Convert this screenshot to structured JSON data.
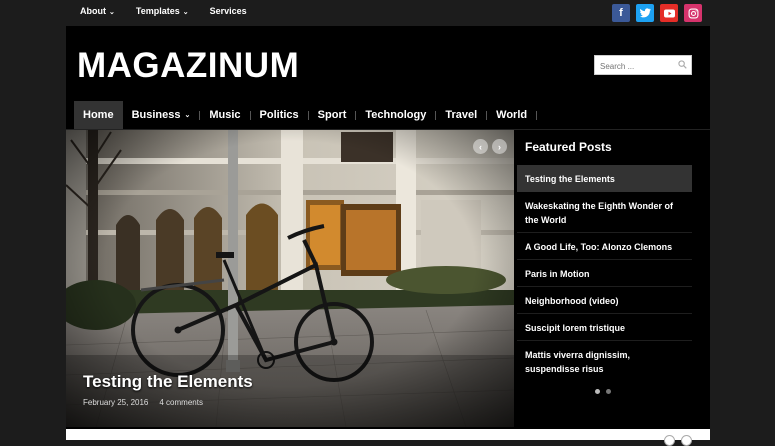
{
  "topnav": {
    "items": [
      {
        "label": "About",
        "has_dropdown": true
      },
      {
        "label": "Templates",
        "has_dropdown": true
      },
      {
        "label": "Services",
        "has_dropdown": false
      }
    ]
  },
  "social": {
    "facebook": {
      "icon": "facebook-icon",
      "glyph": "f",
      "color": "#3b5998"
    },
    "twitter": {
      "icon": "twitter-icon",
      "glyph": "t",
      "color": "#1da1f2"
    },
    "youtube": {
      "icon": "youtube-icon",
      "glyph": "▶",
      "color": "#e52d27"
    },
    "instagram": {
      "icon": "instagram-icon",
      "glyph": "◎",
      "color": "#d6336c"
    }
  },
  "header": {
    "logo": "MAGAZINUM",
    "search_placeholder": "Search ..."
  },
  "mainnav": {
    "items": [
      {
        "label": "Home",
        "active": true
      },
      {
        "label": "Business",
        "has_dropdown": true
      },
      {
        "label": "Music"
      },
      {
        "label": "Politics"
      },
      {
        "label": "Sport"
      },
      {
        "label": "Technology"
      },
      {
        "label": "Travel"
      },
      {
        "label": "World"
      }
    ]
  },
  "slider": {
    "title": "Testing the Elements",
    "date": "February 25, 2016",
    "comments": "4 comments",
    "prev_glyph": "‹",
    "next_glyph": "›"
  },
  "featured": {
    "heading": "Featured Posts",
    "items": [
      "Testing the Elements",
      "Wakeskating the Eighth Wonder of the World",
      "A Good Life, Too: Alonzo Clemons",
      "Paris in Motion",
      "Neighborhood (video)",
      "Suscipit lorem tristique",
      "Mattis viverra dignissim, suspendisse risus"
    ],
    "active_index": 0,
    "dots": 2,
    "active_dot": 0
  },
  "colors": {
    "background": "#1c1c1c",
    "frame": "#000000",
    "active_nav": "#333333"
  }
}
